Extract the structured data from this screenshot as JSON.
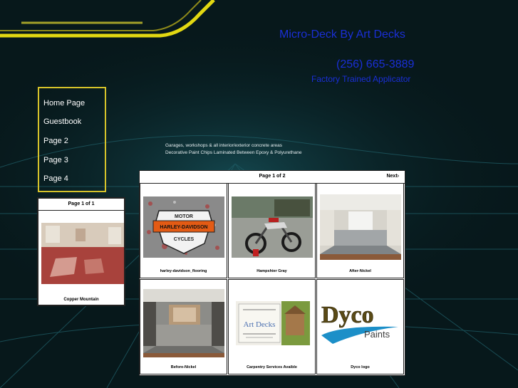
{
  "site": {
    "title": "Micro-Deck  By Art Decks",
    "phone": "(256) 665-3889",
    "subtitle": "Factory Trained Applicator"
  },
  "nav": {
    "items": [
      {
        "label": "Home Page"
      },
      {
        "label": "Guestbook"
      },
      {
        "label": "Page 2"
      },
      {
        "label": "Page 3"
      },
      {
        "label": "Page 4"
      }
    ]
  },
  "description": {
    "line1": "Garages, workshops & all interior/exterior concrete areas",
    "line2": "Decorative Paint Chips Laminated Between Epoxy & Polyurethane"
  },
  "mini_gallery": {
    "page_info": "Page 1 of 1",
    "caption": "Copper Mountain"
  },
  "gallery": {
    "page_info": "Page 1 of 2",
    "next_label": "Next›",
    "items": [
      {
        "caption": "harley-davidson_flooring"
      },
      {
        "caption": "Hampshier Gray"
      },
      {
        "caption": "After-Nickel"
      },
      {
        "caption": "Before-Nickel"
      },
      {
        "caption": "Carpentry Services Avaible"
      },
      {
        "caption": "Dyco logo"
      }
    ]
  },
  "logos": {
    "harley_line1": "MOTOR",
    "harley_line2": "HARLEY-DAVIDSON",
    "harley_line3": "CYCLES",
    "dyco_word": "Dyco",
    "dyco_sub": "Paints",
    "art_decks": "Art Decks"
  },
  "colors": {
    "background": "#07181b",
    "accent_yellow": "#d6c32a",
    "title_blue": "#1a2fd6"
  }
}
